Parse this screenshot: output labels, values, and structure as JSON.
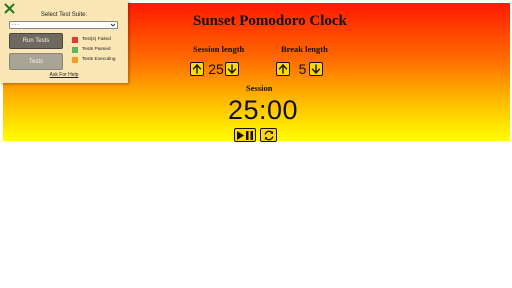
{
  "app": {
    "title": "Sunset Pomodoro Clock",
    "session_length_label": "Session length",
    "break_length_label": "Break length",
    "session_length": "25",
    "break_length": "5",
    "timer_label": "Session",
    "time_left": "25:00",
    "gradient_colors": [
      "#ff1a00",
      "#ff6a00",
      "#ffb800",
      "#ffff00"
    ],
    "button_color": "#ffd800",
    "icons": {
      "increment": "arrow-up-icon",
      "decrement": "arrow-down-icon",
      "start_stop": "play-pause-icon",
      "reset": "refresh-icon"
    }
  },
  "test_panel": {
    "close_icon": "close-x-icon",
    "close_color": "#1e7a1e",
    "select_label": "Select Test Suite:",
    "selected_suite": "- - -",
    "run_button": "Run Tests",
    "tests_button": "Tests",
    "legend": [
      {
        "label": "Test(s) Failed",
        "color": "#e53935"
      },
      {
        "label": "Tests Passed",
        "color": "#5cb85c"
      },
      {
        "label": "Tests Executing",
        "color": "#f0a020"
      }
    ],
    "help_link": "Ask For Help"
  }
}
